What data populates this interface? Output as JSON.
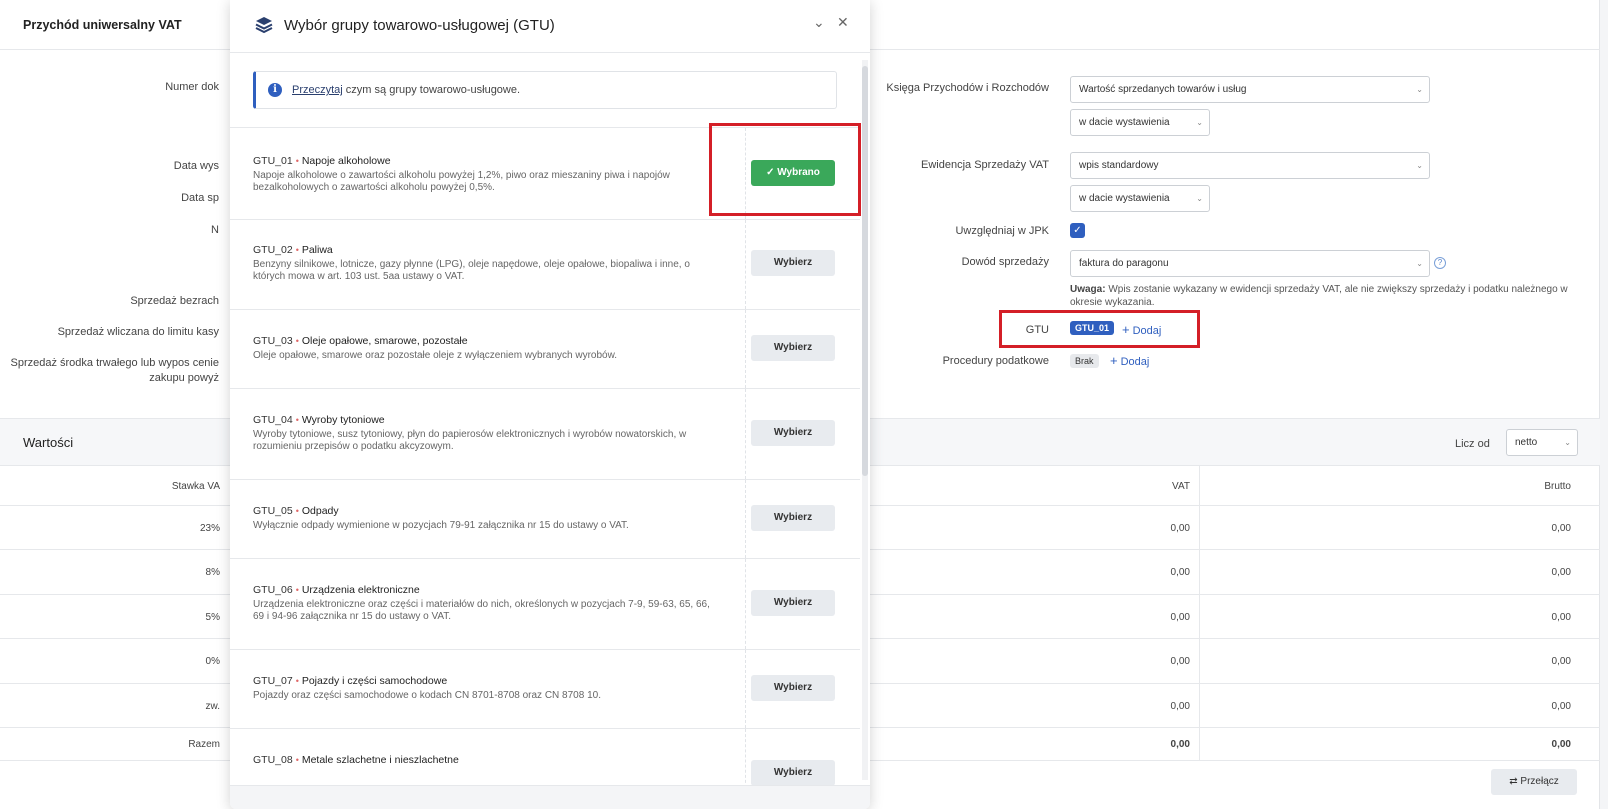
{
  "page": {
    "title": "Przychód uniwersalny VAT",
    "left_labels": [
      "Numer dok",
      "Data wys",
      "Data sp",
      "N",
      "Sprzedaż bezrach",
      "Sprzedaż wliczana do limitu kasy",
      "Sprzedaż środka trwałego lub wypos cenie zakupu powyż"
    ],
    "kpir": {
      "label": "Księga Przychodów i Rozchodów",
      "value": "Wartość sprzedanych towarów i usług",
      "date_value": "w dacie wystawienia"
    },
    "ewidencja": {
      "label": "Ewidencja Sprzedaży VAT",
      "value": "wpis standardowy",
      "date_value": "w dacie wystawienia"
    },
    "jpk": {
      "label": "Uwzględniaj w JPK",
      "checked": true
    },
    "dowod": {
      "label": "Dowód sprzedaży",
      "value": "faktura do paragonu",
      "note_prefix": "Uwaga:",
      "note_text": "Wpis zostanie wykazany w ewidencji sprzedaży VAT, ale nie zwiększy sprzedaży i podatku należnego w okresie wykazania."
    },
    "gtu": {
      "label": "GTU",
      "badge": "GTU_01",
      "add": "Dodaj"
    },
    "procedury": {
      "label": "Procedury podatkowe",
      "badge": "Brak",
      "add": "Dodaj"
    },
    "values": {
      "title": "Wartości",
      "licz_label": "Licz od",
      "licz_value": "netto",
      "headers": {
        "stawka": "Stawka VA",
        "vat": "VAT",
        "brutto": "Brutto"
      },
      "rows": [
        {
          "rate": "23%",
          "vat": "0,00",
          "brutto": "0,00"
        },
        {
          "rate": "8%",
          "vat": "0,00",
          "brutto": "0,00"
        },
        {
          "rate": "5%",
          "vat": "0,00",
          "brutto": "0,00"
        },
        {
          "rate": "0%",
          "vat": "0,00",
          "brutto": "0,00"
        },
        {
          "rate": "zw.",
          "vat": "0,00",
          "brutto": "0,00"
        }
      ],
      "total": {
        "label": "Razem",
        "vat": "0,00",
        "brutto": "0,00"
      },
      "toggle": "Przełącz"
    }
  },
  "modal": {
    "title": "Wybór grupy towarowo-usługowej (GTU)",
    "info_link": "Przeczytaj",
    "info_text": " czym są grupy towarowo-usługowe.",
    "items": [
      {
        "code": "GTU_01",
        "name": "Napoje alkoholowe",
        "desc": "Napoje alkoholowe o zawartości alkoholu powyżej 1,2%, piwo oraz mieszaniny piwa i napojów bezalkoholowych o zawartości alkoholu powyżej 0,5%.",
        "button": "Wybrano",
        "selected": true
      },
      {
        "code": "GTU_02",
        "name": "Paliwa",
        "desc": "Benzyny silnikowe, lotnicze, gazy płynne (LPG), oleje napędowe, oleje opałowe, biopaliwa i inne, o których mowa w art. 103 ust. 5aa ustawy o VAT.",
        "button": "Wybierz",
        "selected": false
      },
      {
        "code": "GTU_03",
        "name": "Oleje opałowe, smarowe, pozostałe",
        "desc": "Oleje opałowe, smarowe oraz pozostałe oleje z wyłączeniem wybranych wyrobów.",
        "button": "Wybierz",
        "selected": false
      },
      {
        "code": "GTU_04",
        "name": "Wyroby tytoniowe",
        "desc": "Wyroby tytoniowe, susz tytoniowy, płyn do papierosów elektronicznych i wyrobów nowatorskich, w rozumieniu przepisów o podatku akcyzowym.",
        "button": "Wybierz",
        "selected": false
      },
      {
        "code": "GTU_05",
        "name": "Odpady",
        "desc": "Wyłącznie odpady wymienione w pozycjach 79-91 załącznika nr 15 do ustawy o VAT.",
        "button": "Wybierz",
        "selected": false
      },
      {
        "code": "GTU_06",
        "name": "Urządzenia elektroniczne",
        "desc": "Urządzenia elektroniczne oraz części i materiałów do nich, określonych w pozycjach 7-9, 59-63, 65, 66, 69 i 94-96 załącznika nr 15 do ustawy o VAT.",
        "button": "Wybierz",
        "selected": false
      },
      {
        "code": "GTU_07",
        "name": "Pojazdy i części samochodowe",
        "desc": "Pojazdy oraz części samochodowe o kodach CN 8701-8708 oraz CN 8708 10.",
        "button": "Wybierz",
        "selected": false
      },
      {
        "code": "GTU_08",
        "name": "Metale szlachetne i nieszlachetne",
        "desc": "",
        "button": "Wybierz",
        "selected": false
      }
    ]
  },
  "colors": {
    "accent": "#2f5fbf",
    "selected": "#3aa85a",
    "highlight": "#d41f27"
  }
}
